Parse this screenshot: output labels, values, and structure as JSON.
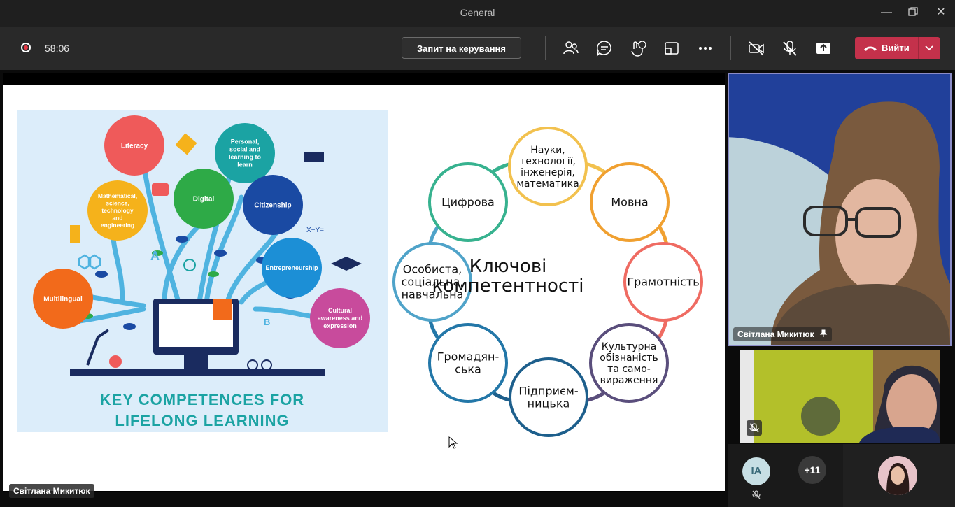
{
  "window": {
    "title": "General"
  },
  "toolbar": {
    "timer": "58:06",
    "request_control_label": "Запит на керування",
    "leave_label": "Вийти"
  },
  "stage": {
    "presenter_name": "Світлана Микитюк",
    "slide": {
      "left_panel": {
        "bubbles": [
          {
            "label": "Literacy",
            "color": "#ef5a5a"
          },
          {
            "label": "Personal, social and learning to learn",
            "color": "#1ba3a3"
          },
          {
            "label": "Mathematical, science, technology and engineering",
            "color": "#f5b21b"
          },
          {
            "label": "Digital",
            "color": "#2eaa47"
          },
          {
            "label": "Citizenship",
            "color": "#1a4aa3"
          },
          {
            "label": "Entrepreneurship",
            "color": "#1c8fd6"
          },
          {
            "label": "Multilingual",
            "color": "#f26a1b"
          },
          {
            "label": "Cultural awareness and expression",
            "color": "#c84b9c"
          }
        ],
        "title_line1": "KEY COMPETENCES FOR",
        "title_line2": "LIFELONG LEARNING",
        "formula": "X+Y=",
        "letter_a": "A",
        "letter_b": "B"
      },
      "right_panel": {
        "center_line1": "Ключові",
        "center_line2": "компетентності",
        "circles": [
          {
            "lines": [
              "Науки,",
              "технології,",
              "інженерія,",
              "математика"
            ],
            "color": "#f2c14e"
          },
          {
            "lines": [
              "Мовна"
            ],
            "color": "#f0a030"
          },
          {
            "lines": [
              "Грамотність"
            ],
            "color": "#ef6b62"
          },
          {
            "lines": [
              "Культурна",
              "обізнаність",
              "та само-",
              "вираження"
            ],
            "color": "#5a4e7c"
          },
          {
            "lines": [
              "Підприєм-",
              "ницька"
            ],
            "color": "#1d5f8c"
          },
          {
            "lines": [
              "Громадян-",
              "ська"
            ],
            "color": "#2377a8"
          },
          {
            "lines": [
              "Особиста,",
              "соціальна,",
              "навчальна"
            ],
            "color": "#4fa3c9"
          },
          {
            "lines": [
              "Цифрова"
            ],
            "color": "#37b28f"
          }
        ]
      }
    }
  },
  "participants": {
    "main": {
      "name": "Світлана Микитюк"
    },
    "avatar_initials": "IA",
    "more_count": "+11"
  },
  "icon_names": [
    "record-icon",
    "participants-icon",
    "chat-icon",
    "reactions-icon",
    "rooms-icon",
    "more-icon",
    "camera-off-icon",
    "mic-off-icon",
    "share-icon",
    "phone-hangup-icon",
    "chevron-down-icon",
    "pin-icon",
    "muted-icon",
    "cursor-icon"
  ]
}
